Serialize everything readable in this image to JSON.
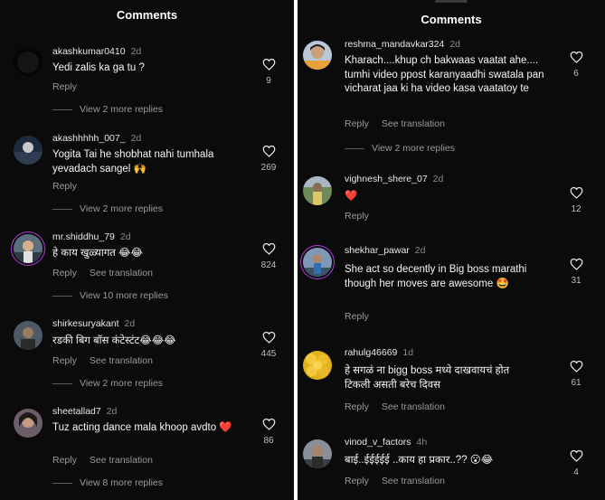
{
  "left": {
    "title": "Comments",
    "comments": [
      {
        "user": "akashkumar0410",
        "time": "2d",
        "text": "Yedi zalis ka ga tu ?",
        "actions": [
          "Reply"
        ],
        "more": "View 2 more replies",
        "likes": "9"
      },
      {
        "user": "akashhhhh_007_",
        "time": "2d",
        "text": "Yogita Tai he shobhat nahi tumhala yevadach sangel 🙌",
        "actions": [
          "Reply"
        ],
        "more": "View 2 more replies",
        "likes": "269"
      },
      {
        "user": "mr.shiddhu_79",
        "time": "2d",
        "text": "हे काय खुळ्यागत 😂😂",
        "actions": [
          "Reply",
          "See translation"
        ],
        "more": "View 10 more replies",
        "likes": "824"
      },
      {
        "user": "shirkesuryakant",
        "time": "2d",
        "text": "रडकी बिग बॉस कंटेस्टंट😂😂😂",
        "actions": [
          "Reply",
          "See translation"
        ],
        "more": "View 2 more replies",
        "likes": "445"
      },
      {
        "user": "sheetallad7",
        "time": "2d",
        "text": "Tuz acting dance mala khoop avdto ❤️",
        "actions": [
          "Reply",
          "See translation"
        ],
        "more": "View 8 more replies",
        "likes": "86"
      }
    ]
  },
  "right": {
    "title": "Comments",
    "comments": [
      {
        "user": "reshma_mandavkar324",
        "time": "2d",
        "text": "Kharach....khup ch bakwaas vaatat ahe.... tumhi video ppost karanyaadhi swatala pan vicharat jaa ki ha video kasa vaatatoy te",
        "actions": [
          "Reply",
          "See translation"
        ],
        "more": "View 2 more replies",
        "likes": "6"
      },
      {
        "user": "vighnesh_shere_07",
        "time": "2d",
        "text": "❤️",
        "actions": [
          "Reply"
        ],
        "more": "",
        "likes": "12"
      },
      {
        "user": "shekhar_pawar",
        "time": "2d",
        "text": "She act so decently in Big boss marathi though her moves are awesome 🤩",
        "actions": [
          "Reply"
        ],
        "more": "",
        "likes": "31"
      },
      {
        "user": "rahulg46669",
        "time": "1d",
        "text": "हे सगळं ना bigg boss मध्ये दाखवायचं होत टिकली असती बरेच दिवस",
        "actions": [
          "Reply",
          "See translation"
        ],
        "more": "",
        "likes": "61"
      },
      {
        "user": "vinod_v_factors",
        "time": "4h",
        "text": "बाई..ईईईईई ..काय हा प्रकार..?? 😮😂",
        "actions": [
          "Reply",
          "See translation"
        ],
        "more": "",
        "likes": "4"
      }
    ]
  },
  "icons": {
    "like": "heart-outline-icon"
  },
  "colors": {
    "background": "#0b0b0b",
    "text": "#f2f2f2",
    "muted": "#9a9a9a",
    "story_ring": "#b23bd6"
  }
}
